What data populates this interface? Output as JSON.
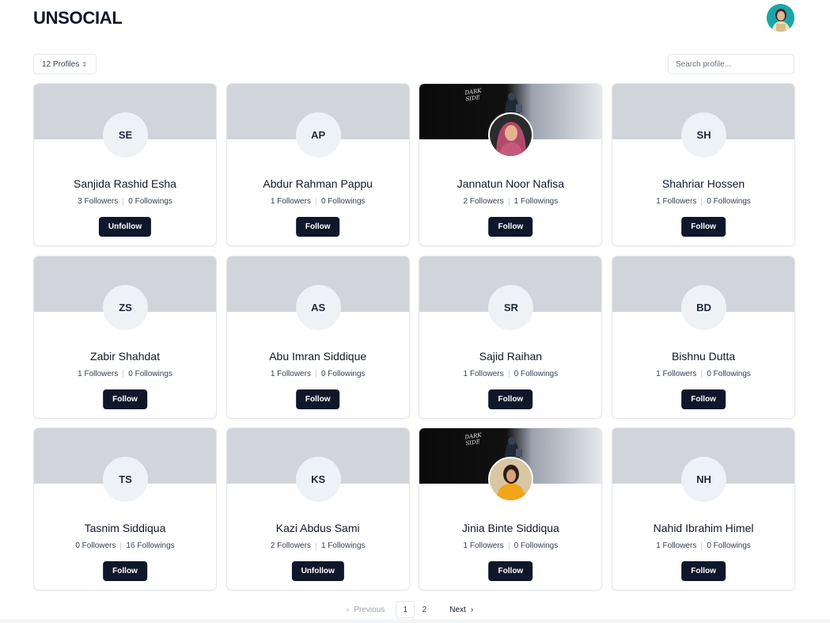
{
  "header": {
    "brand": "UNSOCIAL"
  },
  "toolbar": {
    "profile_count_label": "12 Profiles",
    "search_placeholder": "Search profile..."
  },
  "cover_art_text": "DARK\nSIDE",
  "profiles": [
    {
      "initials": "SE",
      "name": "Sanjida Rashid Esha",
      "followers": "3 Followers",
      "followings": "0 Followings",
      "action": "Unfollow",
      "has_photo": false
    },
    {
      "initials": "AP",
      "name": "Abdur Rahman Pappu",
      "followers": "1 Followers",
      "followings": "0 Followings",
      "action": "Follow",
      "has_photo": false
    },
    {
      "initials": "",
      "name": "Jannatun Noor Nafisa",
      "followers": "2 Followers",
      "followings": "1 Followings",
      "action": "Follow",
      "has_photo": true
    },
    {
      "initials": "SH",
      "name": "Shahriar Hossen",
      "followers": "1 Followers",
      "followings": "0 Followings",
      "action": "Follow",
      "has_photo": false
    },
    {
      "initials": "ZS",
      "name": "Zabir Shahdat",
      "followers": "1 Followers",
      "followings": "0 Followings",
      "action": "Follow",
      "has_photo": false
    },
    {
      "initials": "AS",
      "name": "Abu Imran Siddique",
      "followers": "1 Followers",
      "followings": "0 Followings",
      "action": "Follow",
      "has_photo": false
    },
    {
      "initials": "SR",
      "name": "Sajid Raihan",
      "followers": "1 Followers",
      "followings": "0 Followings",
      "action": "Follow",
      "has_photo": false
    },
    {
      "initials": "BD",
      "name": "Bishnu Dutta",
      "followers": "1 Followers",
      "followings": "0 Followings",
      "action": "Follow",
      "has_photo": false
    },
    {
      "initials": "TS",
      "name": "Tasnim Siddiqua",
      "followers": "0 Followers",
      "followings": "16 Followings",
      "action": "Follow",
      "has_photo": false
    },
    {
      "initials": "KS",
      "name": "Kazi Abdus Sami",
      "followers": "2 Followers",
      "followings": "1 Followings",
      "action": "Unfollow",
      "has_photo": false
    },
    {
      "initials": "",
      "name": "Jinia Binte Siddiqua",
      "followers": "1 Followers",
      "followings": "0 Followings",
      "action": "Follow",
      "has_photo": true
    },
    {
      "initials": "NH",
      "name": "Nahid Ibrahim Himel",
      "followers": "1 Followers",
      "followings": "0 Followings",
      "action": "Follow",
      "has_photo": false
    }
  ],
  "pagination": {
    "previous_label": "Previous",
    "pages": [
      "1",
      "2"
    ],
    "current_page": "1",
    "next_label": "Next"
  },
  "colors": {
    "primary_button": "#0f172a",
    "cover_default": "#d1d5db",
    "avatar_bg": "#eef2f7"
  }
}
